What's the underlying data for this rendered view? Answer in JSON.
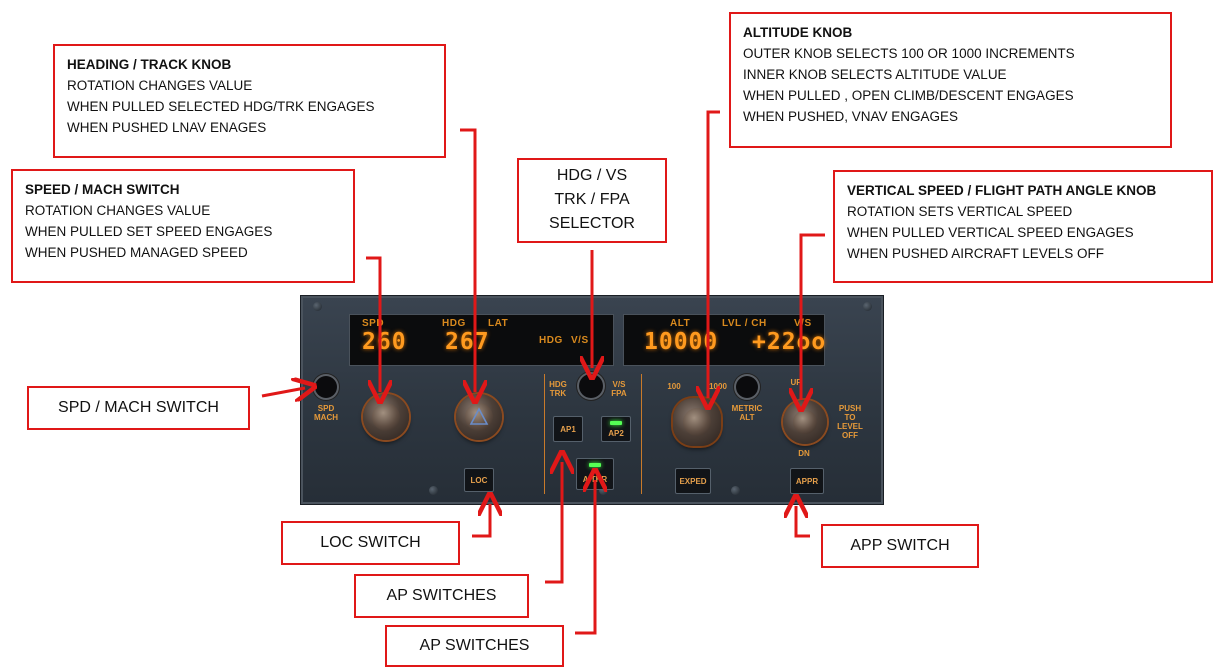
{
  "callouts": {
    "heading": {
      "title": "HEADING / TRACK KNOB",
      "lines": [
        "ROTATION CHANGES VALUE",
        "WHEN PULLED SELECTED HDG/TRK ENGAGES",
        "WHEN PUSHED LNAV ENAGES"
      ]
    },
    "speed": {
      "title": "SPEED / MACH SWITCH",
      "lines": [
        "ROTATION CHANGES VALUE",
        "WHEN PULLED SET SPEED ENGAGES",
        "WHEN PUSHED MANAGED SPEED"
      ]
    },
    "altitude": {
      "title": "ALTITUDE KNOB",
      "lines": [
        "OUTER KNOB SELECTS 100 OR 1000 INCREMENTS",
        "INNER KNOB SELECTS ALTITUDE VALUE",
        "WHEN PULLED , OPEN CLIMB/DESCENT ENGAGES",
        "WHEN PUSHED, VNAV ENGAGES"
      ]
    },
    "vertical": {
      "title": "VERTICAL SPEED / FLIGHT PATH ANGLE KNOB",
      "lines": [
        "ROTATION SETS VERTICAL SPEED",
        "WHEN PULLED VERTICAL SPEED ENGAGES",
        "WHEN PUSHED AIRCRAFT LEVELS OFF"
      ]
    },
    "selector": {
      "lines": [
        "HDG / VS",
        "TRK / FPA",
        "SELECTOR"
      ]
    }
  },
  "labels": {
    "spd_mach": "SPD / MACH SWITCH",
    "loc": "LOC SWITCH",
    "ap1": "AP SWITCHES",
    "ap2": "AP SWITCHES",
    "app": "APP SWITCH"
  },
  "panel": {
    "display": {
      "spd_label": "SPD",
      "spd_value": "260",
      "hdg_label": "HDG",
      "lat_label": "LAT",
      "hdg_value": "267",
      "hdg_mode": "HDG",
      "vs_mode": "V/S",
      "alt_label": "ALT",
      "lvlch_label": "LVL / CH",
      "vs_label": "V/S",
      "alt_value": "10000",
      "vs_value": "+22oo"
    },
    "spd_mach_label": "SPD\nMACH",
    "hdg_trk_label": "HDG\nTRK",
    "vs_fpa_label": "V/S\nFPA",
    "metric_alt_label": "METRIC\nALT",
    "alt_scale_100": "100",
    "alt_scale_1000": "1000",
    "push_level_off": "PUSH\nTO\nLEVEL\nOFF",
    "up": "UP",
    "dn": "DN",
    "buttons": {
      "ap1": "AP1",
      "ap2": "AP2",
      "athr": "A/THR",
      "loc": "LOC",
      "exped": "EXPED",
      "appr": "APPR"
    },
    "lamp_color": "#55ff55",
    "digit_color": "#ff9a1f"
  },
  "arrow_color": "#e01818"
}
